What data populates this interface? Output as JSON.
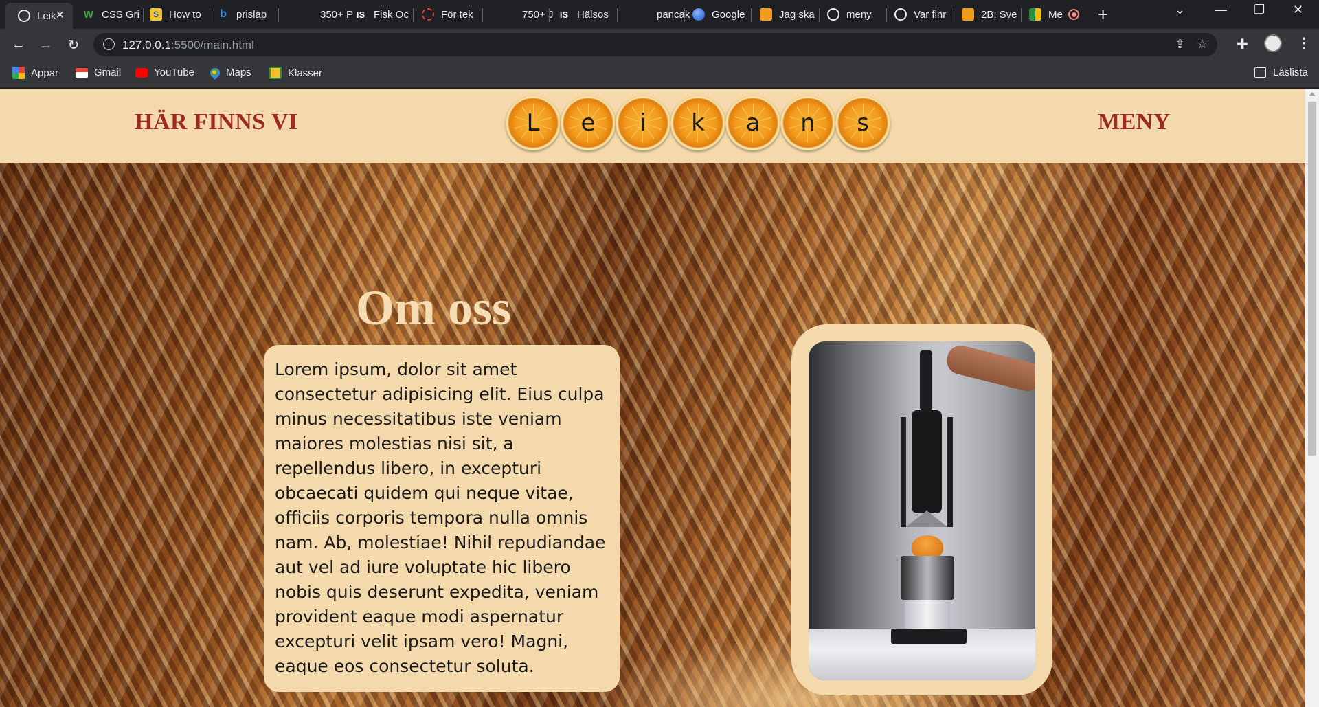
{
  "tabs": [
    {
      "title": "Leik",
      "icon": "globe-icon",
      "active": true
    },
    {
      "title": "CSS Gri",
      "icon": "w-icon"
    },
    {
      "title": "How to",
      "icon": "s-icon"
    },
    {
      "title": "prislap",
      "icon": "bing-icon"
    },
    {
      "title": "350+ P",
      "icon": "blank-icon"
    },
    {
      "title": "Fisk Oc",
      "icon": "is-icon"
    },
    {
      "title": "För tek",
      "icon": "sketchy-icon"
    },
    {
      "title": "750+ J",
      "icon": "blank-icon"
    },
    {
      "title": "Hälsos",
      "icon": "is-icon"
    },
    {
      "title": "pancak",
      "icon": "blank-icon"
    },
    {
      "title": "Google",
      "icon": "google-icon"
    },
    {
      "title": "Jag ska",
      "icon": "classroom-icon"
    },
    {
      "title": "meny",
      "icon": "globe-icon"
    },
    {
      "title": "Var finr",
      "icon": "globe-icon"
    },
    {
      "title": "2B: Sve",
      "icon": "classroom-icon"
    },
    {
      "title": "Me",
      "icon": "meet-icon"
    }
  ],
  "address_bar": {
    "url_host": "127.0.0.1",
    "url_path": ":5500/main.html"
  },
  "bookmarks": [
    {
      "label": "Appar",
      "icon": "apps-grid-icon"
    },
    {
      "label": "Gmail",
      "icon": "gmail-icon"
    },
    {
      "label": "YouTube",
      "icon": "youtube-icon"
    },
    {
      "label": "Maps",
      "icon": "maps-icon"
    },
    {
      "label": "Klasser",
      "icon": "classroom-icon"
    }
  ],
  "reading_list_label": "Läslista",
  "site": {
    "nav_left": "HÄR FINNS VI",
    "nav_right": "MENY",
    "logo_letters": [
      "L",
      "e",
      "i",
      "k",
      "a",
      "n",
      "s"
    ],
    "about_title": "Om oss",
    "about_text": "Lorem ipsum, dolor sit amet consectetur adipisicing elit. Eius culpa minus necessitatibus iste veniam maiores molestias nisi sit, a repellendus libero, in excepturi obcaecati quidem qui neque vitae, officiis corporis tempora nulla omnis nam. Ab, molestiae! Nihil repudiandae aut vel ad iure voluptate hic libero nobis quis deserunt expedita, veniam provident eaque modi aspernatur excepturi velit ipsam vero! Magni, eaque eos consectetur soluta.",
    "colors": {
      "header_bg": "#f4d9ad",
      "nav_text": "#9d2b22",
      "title_text": "#f6dcb3"
    }
  }
}
